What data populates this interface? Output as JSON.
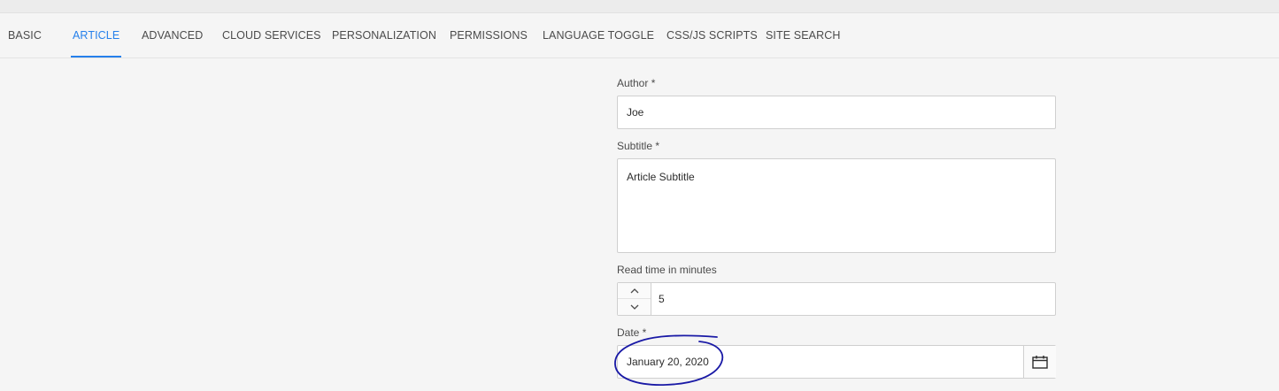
{
  "tabs": [
    {
      "label": "BASIC",
      "active": false
    },
    {
      "label": "ARTICLE",
      "active": true
    },
    {
      "label": "ADVANCED",
      "active": false
    },
    {
      "label": "CLOUD SERVICES",
      "active": false
    },
    {
      "label": "PERSONALIZATION",
      "active": false
    },
    {
      "label": "PERMISSIONS",
      "active": false
    },
    {
      "label": "LANGUAGE TOGGLE",
      "active": false
    },
    {
      "label": "CSS/JS SCRIPTS",
      "active": false
    },
    {
      "label": "SITE SEARCH",
      "active": false
    }
  ],
  "form": {
    "author": {
      "label": "Author *",
      "value": "Joe"
    },
    "subtitle": {
      "label": "Subtitle *",
      "value": "Article Subtitle"
    },
    "read_time": {
      "label": "Read time in minutes",
      "value": "5"
    },
    "date": {
      "label": "Date *",
      "value": "January 20, 2020"
    }
  },
  "icons": {
    "step_up": "chevron-up-icon",
    "step_down": "chevron-down-icon",
    "calendar": "calendar-icon"
  },
  "colors": {
    "accent": "#2680eb",
    "annotation": "#1a1aa6"
  }
}
